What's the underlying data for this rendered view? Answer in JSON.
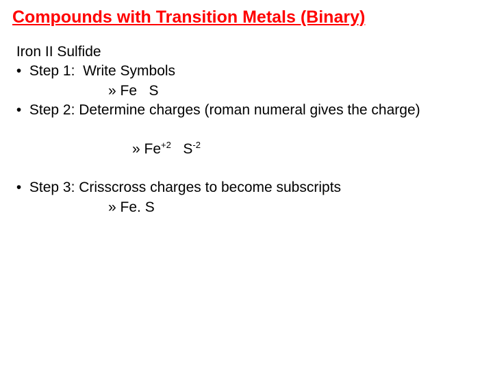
{
  "title": "Compounds with Transition Metals (Binary)",
  "compound_name": " Iron II Sulfide",
  "step1_label": " •  Step 1:  Write Symbols",
  "step1_sub": "» Fe   S",
  "step2_label": " •  Step 2: Determine charges (roman numeral gives the charge)",
  "step2_sub_prefix": "» Fe",
  "step2_fe_charge": "+2",
  "step2_sub_mid": "   S",
  "step2_s_charge": "-2",
  "step3_label": " •  Step 3: Crisscross charges to become subscripts",
  "step3_sub": "» Fe. S"
}
